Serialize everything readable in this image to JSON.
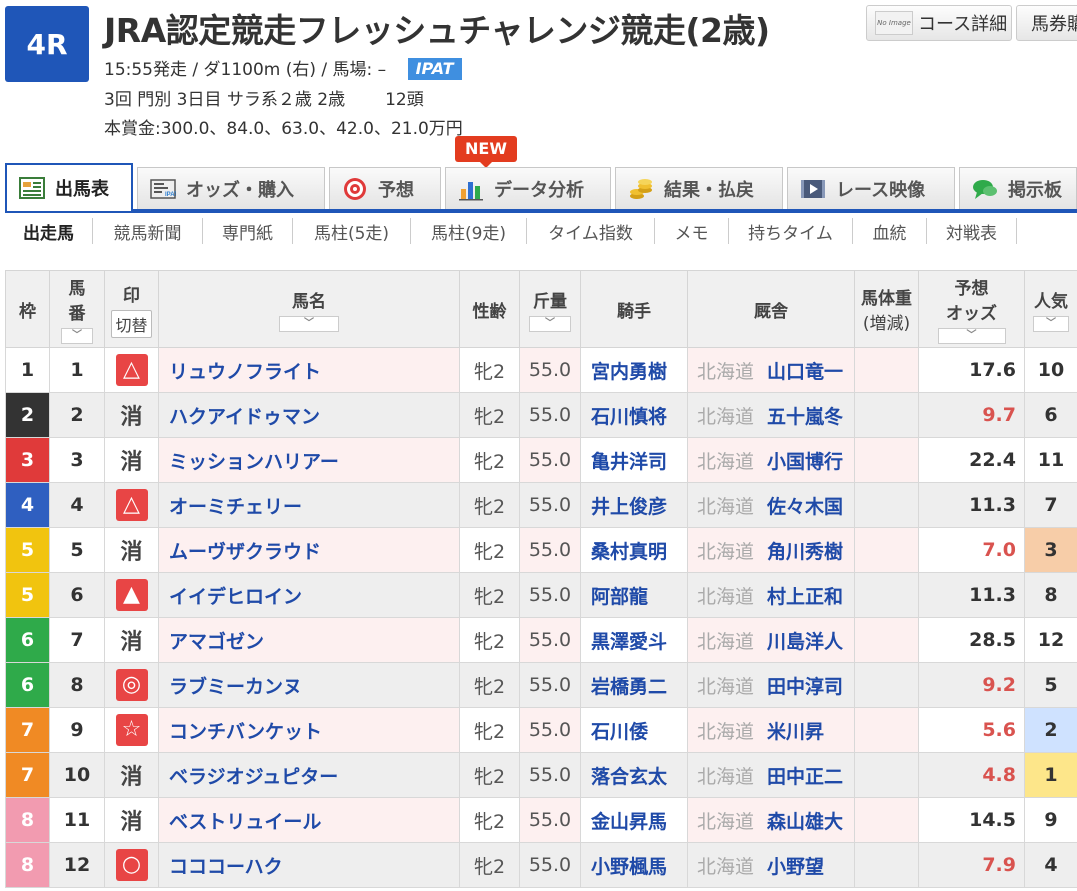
{
  "race": {
    "number": "4R",
    "title": "JRA認定競走フレッシュチャレンジ競走(2歳)",
    "line1": "15:55発走 / ダ1100m (右) / 馬場: –",
    "ipat": "IPAT",
    "line2a": "3回 門別 3日目 サラ系２歳 2歳",
    "line2b": "12頭",
    "line3": "本賞金:300.0、84.0、63.0、42.0、21.0万円"
  },
  "top_buttons": {
    "course": "コース詳細",
    "noimage": "No Image",
    "baken": "馬券購入"
  },
  "new_badge": "NEW",
  "tabs": [
    {
      "label": "出馬表",
      "icon": "entry-table-icon"
    },
    {
      "label": "オッズ・購入",
      "icon": "ipat-ticket-icon"
    },
    {
      "label": "予想",
      "icon": "target-icon"
    },
    {
      "label": "データ分析",
      "icon": "bar-chart-icon"
    },
    {
      "label": "結果・払戻",
      "icon": "coins-icon"
    },
    {
      "label": "レース映像",
      "icon": "video-icon"
    },
    {
      "label": "掲示板",
      "icon": "chat-bubble-icon"
    }
  ],
  "subnav": [
    "出走馬",
    "競馬新聞",
    "専門紙",
    "馬柱(5走)",
    "馬柱(9走)",
    "タイム指数",
    "メモ",
    "持ちタイム",
    "血統",
    "対戦表"
  ],
  "headers": {
    "waku": "枠",
    "umaban1": "馬",
    "umaban2": "番",
    "mark": "印",
    "mark_toggle": "切替",
    "name": "馬名",
    "sexage": "性齢",
    "weight": "斤量",
    "jockey": "騎手",
    "stable": "厩舎",
    "bodyweight1": "馬体重",
    "bodyweight2": "(増減)",
    "odds1": "予想",
    "odds2": "オッズ",
    "popularity": "人気",
    "sort": "﹀"
  },
  "colors": {
    "accent": "#1f56b8",
    "waku": {
      "1": "#ffffff",
      "2": "#333333",
      "3": "#e03a3a",
      "4": "#2f5fc0",
      "5": "#f1c40f",
      "6": "#2faa4a",
      "7": "#f08a24",
      "8": "#f29bb0"
    },
    "odds_red": "#d9534f",
    "pop1": "#fde68a",
    "pop2": "#cfe2ff",
    "pop3": "#f7cda8"
  },
  "rows": [
    {
      "waku": "1",
      "num": "1",
      "mark": "△",
      "mark_style": "red",
      "name": "リュウノフライト",
      "sexage": "牝2",
      "weight": "55.0",
      "jockey": "宮内勇樹",
      "region": "北海道",
      "trainer": "山口竜一",
      "odds": "17.6",
      "odds_red": false,
      "pop": "10"
    },
    {
      "waku": "2",
      "num": "2",
      "mark": "消",
      "mark_style": "kesu",
      "name": "ハクアイドゥマン",
      "sexage": "牝2",
      "weight": "55.0",
      "jockey": "石川慎将",
      "region": "北海道",
      "trainer": "五十嵐冬",
      "odds": "9.7",
      "odds_red": true,
      "pop": "6"
    },
    {
      "waku": "3",
      "num": "3",
      "mark": "消",
      "mark_style": "kesu",
      "name": "ミッションハリアー",
      "sexage": "牝2",
      "weight": "55.0",
      "jockey": "亀井洋司",
      "region": "北海道",
      "trainer": "小国博行",
      "odds": "22.4",
      "odds_red": false,
      "pop": "11"
    },
    {
      "waku": "4",
      "num": "4",
      "mark": "△",
      "mark_style": "red",
      "name": "オーミチェリー",
      "sexage": "牝2",
      "weight": "55.0",
      "jockey": "井上俊彦",
      "region": "北海道",
      "trainer": "佐々木国",
      "odds": "11.3",
      "odds_red": false,
      "pop": "7"
    },
    {
      "waku": "5",
      "num": "5",
      "mark": "消",
      "mark_style": "kesu",
      "name": "ムーヴザクラウド",
      "sexage": "牝2",
      "weight": "55.0",
      "jockey": "桑村真明",
      "region": "北海道",
      "trainer": "角川秀樹",
      "odds": "7.0",
      "odds_red": true,
      "pop": "3"
    },
    {
      "waku": "5",
      "num": "6",
      "mark": "▲",
      "mark_style": "red",
      "name": "イイデヒロイン",
      "sexage": "牝2",
      "weight": "55.0",
      "jockey": "阿部龍",
      "region": "北海道",
      "trainer": "村上正和",
      "odds": "11.3",
      "odds_red": false,
      "pop": "8"
    },
    {
      "waku": "6",
      "num": "7",
      "mark": "消",
      "mark_style": "kesu",
      "name": "アマゴゼン",
      "sexage": "牝2",
      "weight": "55.0",
      "jockey": "黒澤愛斗",
      "region": "北海道",
      "trainer": "川島洋人",
      "odds": "28.5",
      "odds_red": false,
      "pop": "12"
    },
    {
      "waku": "6",
      "num": "8",
      "mark": "◎",
      "mark_style": "red",
      "name": "ラブミーカンヌ",
      "sexage": "牝2",
      "weight": "55.0",
      "jockey": "岩橋勇二",
      "region": "北海道",
      "trainer": "田中淳司",
      "odds": "9.2",
      "odds_red": true,
      "pop": "5"
    },
    {
      "waku": "7",
      "num": "9",
      "mark": "☆",
      "mark_style": "red",
      "name": "コンチバンケット",
      "sexage": "牝2",
      "weight": "55.0",
      "jockey": "石川倭",
      "region": "北海道",
      "trainer": "米川昇",
      "odds": "5.6",
      "odds_red": true,
      "pop": "2"
    },
    {
      "waku": "7",
      "num": "10",
      "mark": "消",
      "mark_style": "kesu",
      "name": "ベラジオジュピター",
      "sexage": "牝2",
      "weight": "55.0",
      "jockey": "落合玄太",
      "region": "北海道",
      "trainer": "田中正二",
      "odds": "4.8",
      "odds_red": true,
      "pop": "1"
    },
    {
      "waku": "8",
      "num": "11",
      "mark": "消",
      "mark_style": "kesu",
      "name": "ベストリュイール",
      "sexage": "牝2",
      "weight": "55.0",
      "jockey": "金山昇馬",
      "region": "北海道",
      "trainer": "森山雄大",
      "odds": "14.5",
      "odds_red": false,
      "pop": "9"
    },
    {
      "waku": "8",
      "num": "12",
      "mark": "○",
      "mark_style": "red",
      "name": "コココーハク",
      "sexage": "牝2",
      "weight": "55.0",
      "jockey": "小野楓馬",
      "region": "北海道",
      "trainer": "小野望",
      "odds": "7.9",
      "odds_red": true,
      "pop": "4"
    }
  ]
}
